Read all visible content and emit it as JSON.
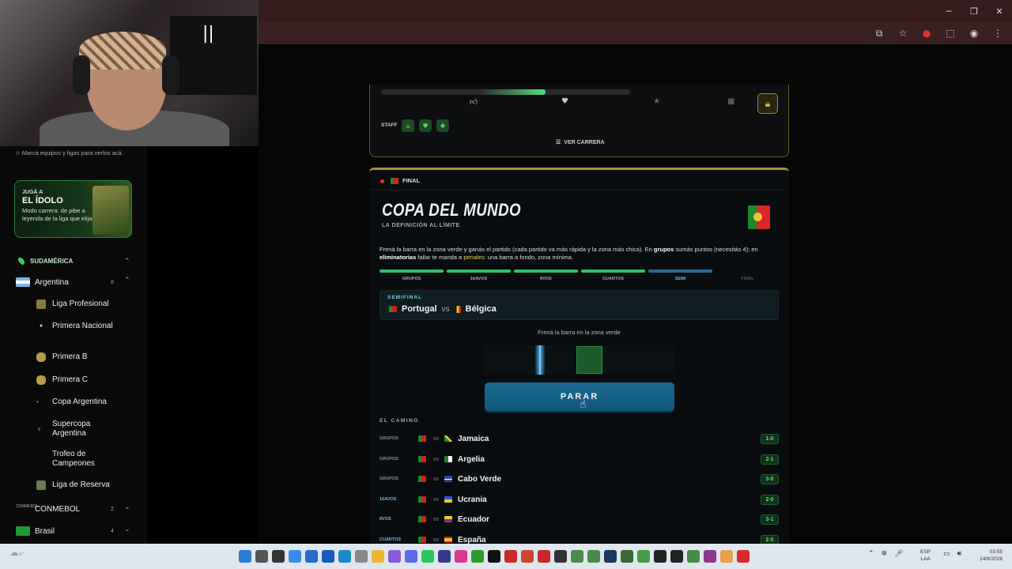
{
  "browser": {
    "window_controls": {
      "minimize": "─",
      "restore": "❐",
      "close": "✕"
    },
    "toolbar_icons": [
      "cast-icon",
      "star-icon",
      "extension-red-icon",
      "extensions-icon",
      "profile-icon",
      "menu-icon"
    ]
  },
  "webcam": {
    "pause_glyph": "||"
  },
  "sidebar": {
    "hint": "☆  Marcá equipos y ligas para verlos acá.",
    "promo": {
      "kicker": "JUGÁ A",
      "title": "EL ÍDOLO",
      "desc": "Modo carrera: de pibe a leyenda de la liga que elijas"
    },
    "region": {
      "label": "SUDAMÉRICA"
    },
    "countries": [
      {
        "label": "Argentina",
        "count": "8"
      },
      {
        "label": "CONMEBOL",
        "count": "2"
      },
      {
        "label": "Brasil",
        "count": "4"
      }
    ],
    "leagues": [
      {
        "label": "Liga Profesional"
      },
      {
        "label": "Primera Nacional"
      },
      {
        "label": "Primera B"
      },
      {
        "label": "Primera C"
      },
      {
        "label": "Copa Argentina"
      },
      {
        "label": "Supercopa Argentina"
      },
      {
        "label": "Trofeo de Campeones"
      },
      {
        "label": "Liga de Reserva"
      }
    ]
  },
  "career": {
    "progress_fraction": 0.66,
    "milestones": [
      "thumbs-up-icon",
      "heart-icon",
      "star-icon",
      "trophy-icon"
    ],
    "staff_label": "STAFF",
    "staff_icons": [
      "house-icon",
      "heart-icon",
      "pill-icon"
    ],
    "ver_carrera": "VER CARRERA"
  },
  "game": {
    "phase_tag": "FINAL",
    "title": "COPA DEL MUNDO",
    "subtitle": "LA DEFINICIÓN AL LÍMITE",
    "desc_1": "Frená la barra en la zona verde y ganás el partido (cada partido va más rápida y la zona más chica). En ",
    "desc_grupos": "grupos",
    "desc_2": " sumás puntos (necesitás 4); en ",
    "desc_elim": "eliminatorias",
    "desc_3": " fallar te manda a ",
    "desc_penales": "penales",
    "desc_4": ": una barra a fondo, zona mínima.",
    "stages": [
      {
        "label": "GRUPOS",
        "state": "done"
      },
      {
        "label": "16AVOS",
        "state": "done"
      },
      {
        "label": "8VOS",
        "state": "done"
      },
      {
        "label": "CUARTOS",
        "state": "done"
      },
      {
        "label": "SEMI",
        "state": "current"
      },
      {
        "label": "FINAL",
        "state": "pending"
      }
    ],
    "match": {
      "kicker": "SEMIFINAL",
      "home": "Portugal",
      "vs": "vs",
      "away": "Bélgica"
    },
    "instruction": "Frená la barra en la zona verde",
    "button": "PARAR",
    "camino_title": "EL CAMINO",
    "road": [
      {
        "phase": "GRUPOS",
        "vs": "vs",
        "opponent": "Jamaica",
        "score": "1-0"
      },
      {
        "phase": "GRUPOS",
        "vs": "vs",
        "opponent": "Argelia",
        "score": "2-1"
      },
      {
        "phase": "GRUPOS",
        "vs": "vs",
        "opponent": "Cabo Verde",
        "score": "3-0"
      },
      {
        "phase": "16AVOS",
        "vs": "vs",
        "opponent": "Ucrania",
        "score": "2-0"
      },
      {
        "phase": "8VOS",
        "vs": "vs",
        "opponent": "Ecuador",
        "score": "3-1"
      },
      {
        "phase": "CUARTOS",
        "vs": "vs",
        "opponent": "España",
        "score": "2-0"
      }
    ]
  },
  "taskbar": {
    "lang_1": "ESP",
    "lang_2": "LAA",
    "time": "03:55",
    "date": "14/8/2026",
    "weather_temp": "9°"
  }
}
